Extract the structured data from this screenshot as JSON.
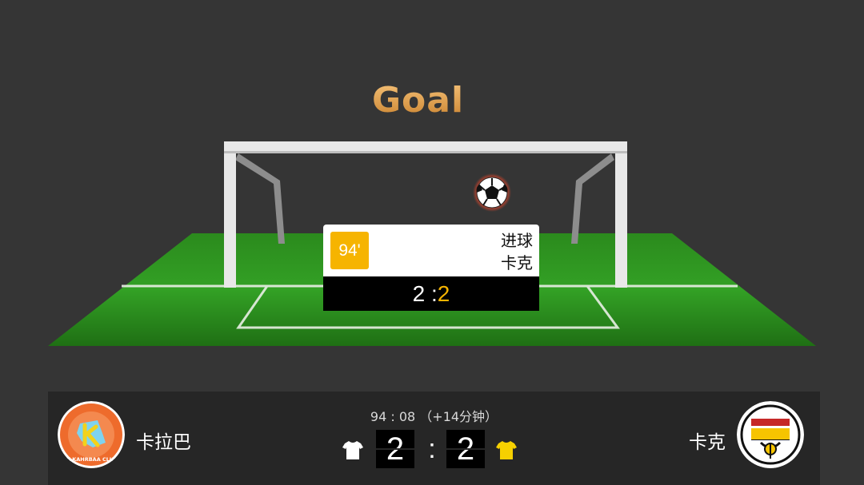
{
  "animation": {
    "title": "Goal"
  },
  "event_card": {
    "minute": "94'",
    "event_type": "进球",
    "team": "卡克",
    "home_score": "2",
    "separator": ":",
    "away_score": "2"
  },
  "scorebar": {
    "match_time": "94 : 08  （+14分钟）",
    "home": {
      "name": "卡拉巴",
      "score": "2",
      "crest_text": "ALKAHRBAA CLUB",
      "shirt_color": "#ffffff"
    },
    "separator": ":",
    "away": {
      "name": "卡克",
      "score": "2",
      "shirt_color": "#f6d000"
    }
  },
  "colors": {
    "background": "#353535",
    "pitch": "#2f8f22",
    "accent": "#f6b400",
    "title_gold": "#e3a04a"
  },
  "icons": [
    "soccer-ball-icon",
    "home-shirt-icon",
    "away-shirt-icon"
  ]
}
